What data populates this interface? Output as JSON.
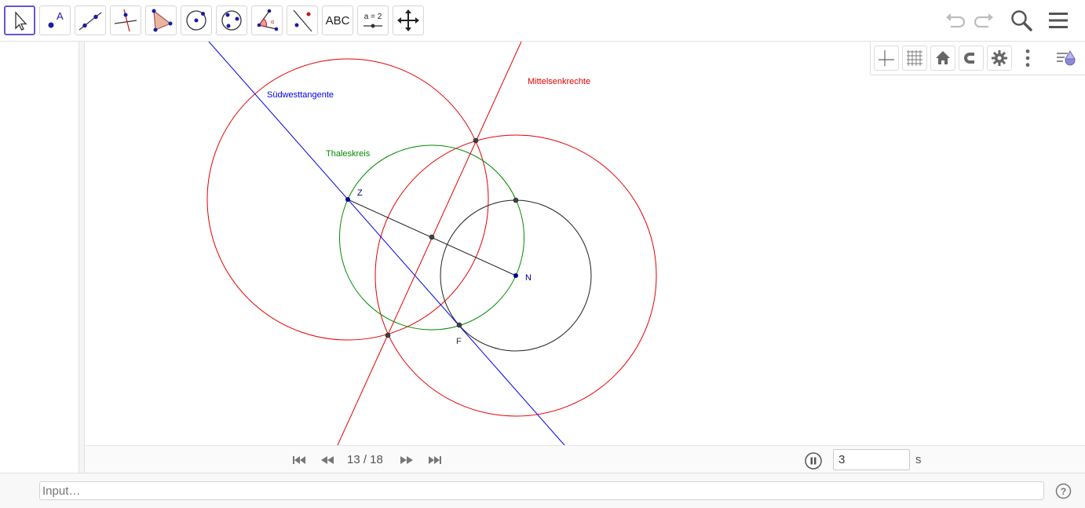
{
  "toolbar": {
    "tools": [
      {
        "name": "move-tool"
      },
      {
        "name": "point-tool",
        "label": "A"
      },
      {
        "name": "line-tool"
      },
      {
        "name": "perpendicular-line-tool"
      },
      {
        "name": "polygon-tool"
      },
      {
        "name": "circle-center-point-tool"
      },
      {
        "name": "circle-three-points-tool"
      },
      {
        "name": "angle-tool"
      },
      {
        "name": "reflect-about-line-tool"
      },
      {
        "name": "text-tool",
        "label": "ABC"
      },
      {
        "name": "slider-tool",
        "label": "a = 2"
      },
      {
        "name": "move-graphics-view-tool"
      }
    ]
  },
  "graphics": {
    "labels": {
      "tangent": "Südwesttangente",
      "bisector": "Mittelsenkrechte",
      "thales": "Thaleskreis",
      "Z": "Z",
      "N": "N",
      "F": "F"
    },
    "colors": {
      "blue": "#0000e6",
      "red": "#e60000",
      "green": "#008a00",
      "black": "#222222",
      "point_blue": "#00008b",
      "point_gray": "#404040"
    }
  },
  "playback": {
    "step_text": "13 / 18",
    "speed_value": "3",
    "speed_unit": "s"
  },
  "inputbar": {
    "placeholder": "Input…"
  }
}
